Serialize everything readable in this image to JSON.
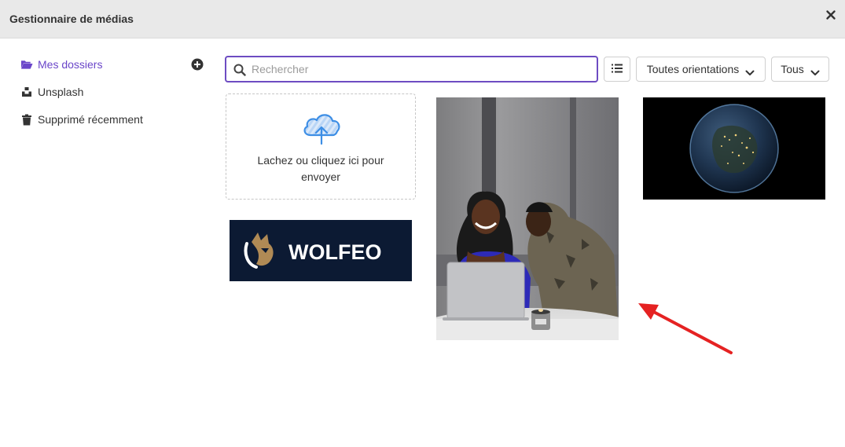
{
  "header": {
    "title": "Gestionnaire de médias",
    "close_icon": "close-icon"
  },
  "sidebar": {
    "items": [
      {
        "label": "Mes dossiers",
        "icon": "folder-open-icon",
        "active": true
      },
      {
        "label": "Unsplash",
        "icon": "unsplash-icon",
        "active": false
      },
      {
        "label": "Supprimé récemment",
        "icon": "trash-icon",
        "active": false
      }
    ],
    "add_icon": "plus-circle-icon"
  },
  "toolbar": {
    "search_placeholder": "Rechercher",
    "search_value": "",
    "view_toggle_icon": "list-view-icon",
    "orientation_label": "Toutes orientations",
    "type_label": "Tous"
  },
  "upload": {
    "label": "Lachez ou cliquez ici pour envoyer",
    "icon": "cloud-upload-icon"
  },
  "media": [
    {
      "kind": "photo",
      "subject": "two people laughing at a laptop"
    },
    {
      "kind": "photo",
      "subject": "earth from space at night"
    },
    {
      "kind": "logo",
      "text": "WOLFEO"
    }
  ],
  "colors": {
    "accent": "#6a45c9",
    "header_bg": "#e9e9e9",
    "annotation": "#e52222"
  }
}
